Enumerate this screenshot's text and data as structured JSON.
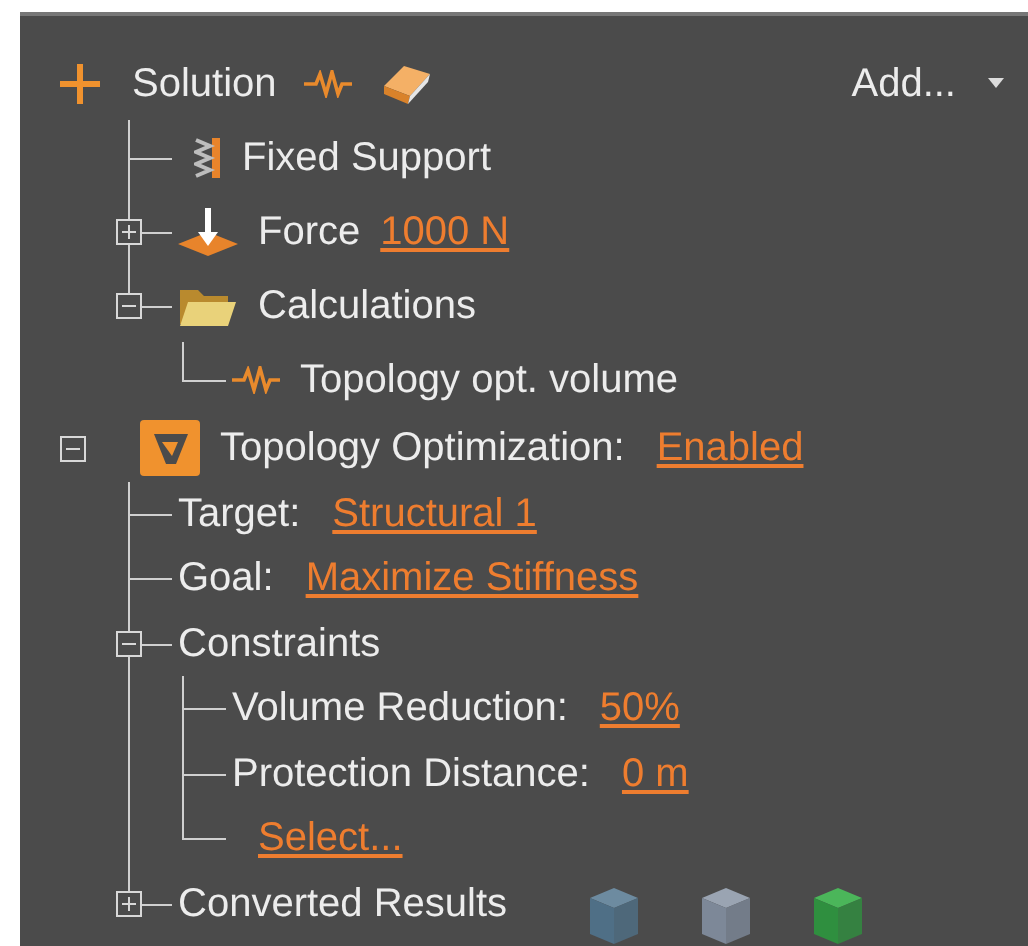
{
  "solution": {
    "label": "Solution",
    "add_button": "Add...",
    "children": [
      {
        "kind": "support",
        "label": "Fixed Support"
      },
      {
        "kind": "force",
        "label": "Force",
        "value": "1000 N",
        "expanded": false
      },
      {
        "kind": "folder",
        "label": "Calculations",
        "expanded": true,
        "children": [
          {
            "kind": "result",
            "label": "Topology opt. volume"
          }
        ]
      }
    ]
  },
  "topology": {
    "label": "Topology Optimization:",
    "value": "Enabled",
    "expanded": true,
    "children": [
      {
        "kind": "parameter",
        "label": "Target:",
        "value": "Structural 1"
      },
      {
        "kind": "parameter",
        "label": "Goal:",
        "value": "Maximize Stiffness"
      },
      {
        "kind": "group",
        "label": "Constraints",
        "expanded": true,
        "children": [
          {
            "kind": "parameter",
            "label": "Volume Reduction:",
            "value": "50%"
          },
          {
            "kind": "parameter",
            "label": "Protection Distance:",
            "value": "0 m"
          },
          {
            "kind": "link",
            "value": "Select..."
          }
        ]
      },
      {
        "kind": "results",
        "label": "Converted Results",
        "expanded": false
      }
    ]
  }
}
